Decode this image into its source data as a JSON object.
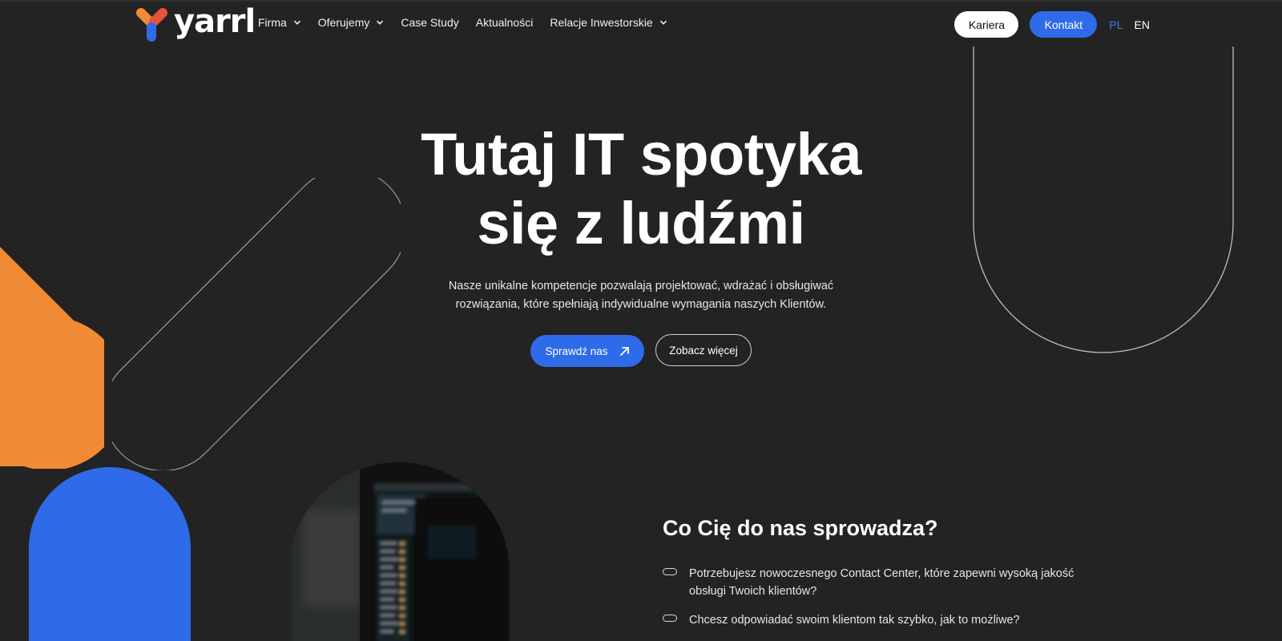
{
  "brand": {
    "name": "yarrl",
    "colors": {
      "orange": "#f08a34",
      "red": "#e5533b",
      "blue": "#2f6be8",
      "background": "#232323"
    }
  },
  "nav": {
    "items": [
      {
        "label": "Firma",
        "has_dropdown": true
      },
      {
        "label": "Oferujemy",
        "has_dropdown": true
      },
      {
        "label": "Case Study",
        "has_dropdown": false
      },
      {
        "label": "Aktualności",
        "has_dropdown": false
      },
      {
        "label": "Relacje Inwestorskie",
        "has_dropdown": true
      }
    ]
  },
  "header": {
    "kariera_label": "Kariera",
    "kontakt_label": "Kontakt",
    "lang_pl": "PL",
    "lang_en": "EN",
    "active_lang": "PL"
  },
  "hero": {
    "title_line1": "Tutaj IT spotyka",
    "title_line2": "się z ludźmi",
    "subtitle_line1": "Nasze unikalne kompetencje pozwalają projektować, wdrażać i obsługiwać",
    "subtitle_line2": "rozwiązania, które spełniają indywidualne wymagania naszych Klientów.",
    "primary_button": "Sprawdź nas",
    "primary_button_icon": "arrow-up-right-icon",
    "secondary_button": "Zobacz więcej"
  },
  "section": {
    "title": "Co Cię do nas sprowadza?",
    "questions": [
      {
        "line1": "Potrzebujesz nowoczesnego Contact Center, które zapewni wysoką jakość",
        "line2": "obsługi Twoich klientów?"
      },
      {
        "line1": "Chcesz odpowiadać swoim klientom tak szybko, jak to możliwe?",
        "line2": ""
      }
    ]
  }
}
